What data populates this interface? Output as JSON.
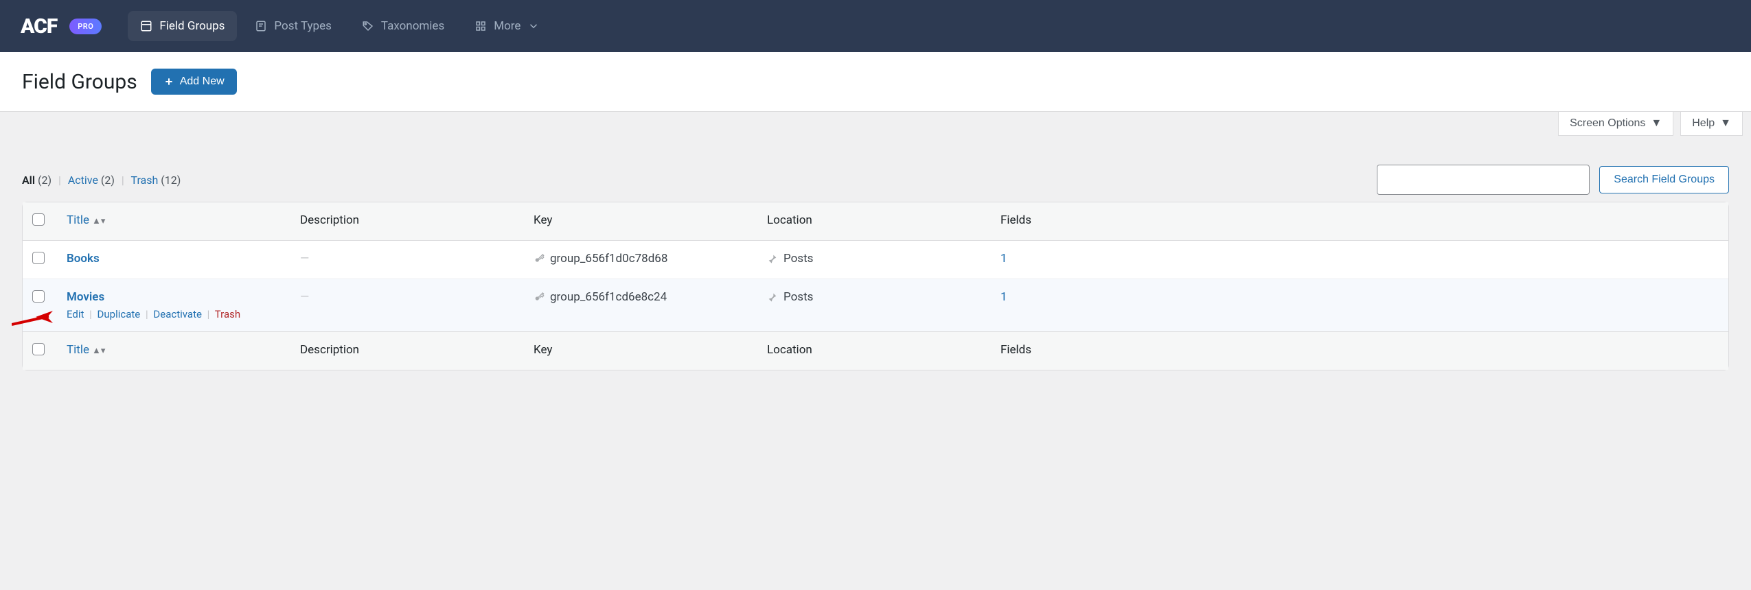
{
  "brand": {
    "logo": "ACF",
    "badge": "PRO"
  },
  "nav": {
    "field_groups": "Field Groups",
    "post_types": "Post Types",
    "taxonomies": "Taxonomies",
    "more": "More"
  },
  "header": {
    "title": "Field Groups",
    "add_new": "Add New"
  },
  "screen": {
    "options": "Screen Options",
    "help": "Help"
  },
  "filters": {
    "all_label": "All",
    "all_count": "(2)",
    "active_label": "Active",
    "active_count": "(2)",
    "trash_label": "Trash",
    "trash_count": "(12)"
  },
  "search": {
    "button": "Search Field Groups"
  },
  "columns": {
    "title": "Title",
    "description": "Description",
    "key": "Key",
    "location": "Location",
    "fields": "Fields"
  },
  "rows": [
    {
      "title": "Books",
      "description": "—",
      "key": "group_656f1d0c78d68",
      "location": "Posts",
      "fields": "1"
    },
    {
      "title": "Movies",
      "description": "—",
      "key": "group_656f1cd6e8c24",
      "location": "Posts",
      "fields": "1"
    }
  ],
  "row_actions": {
    "edit": "Edit",
    "duplicate": "Duplicate",
    "deactivate": "Deactivate",
    "trash": "Trash"
  }
}
